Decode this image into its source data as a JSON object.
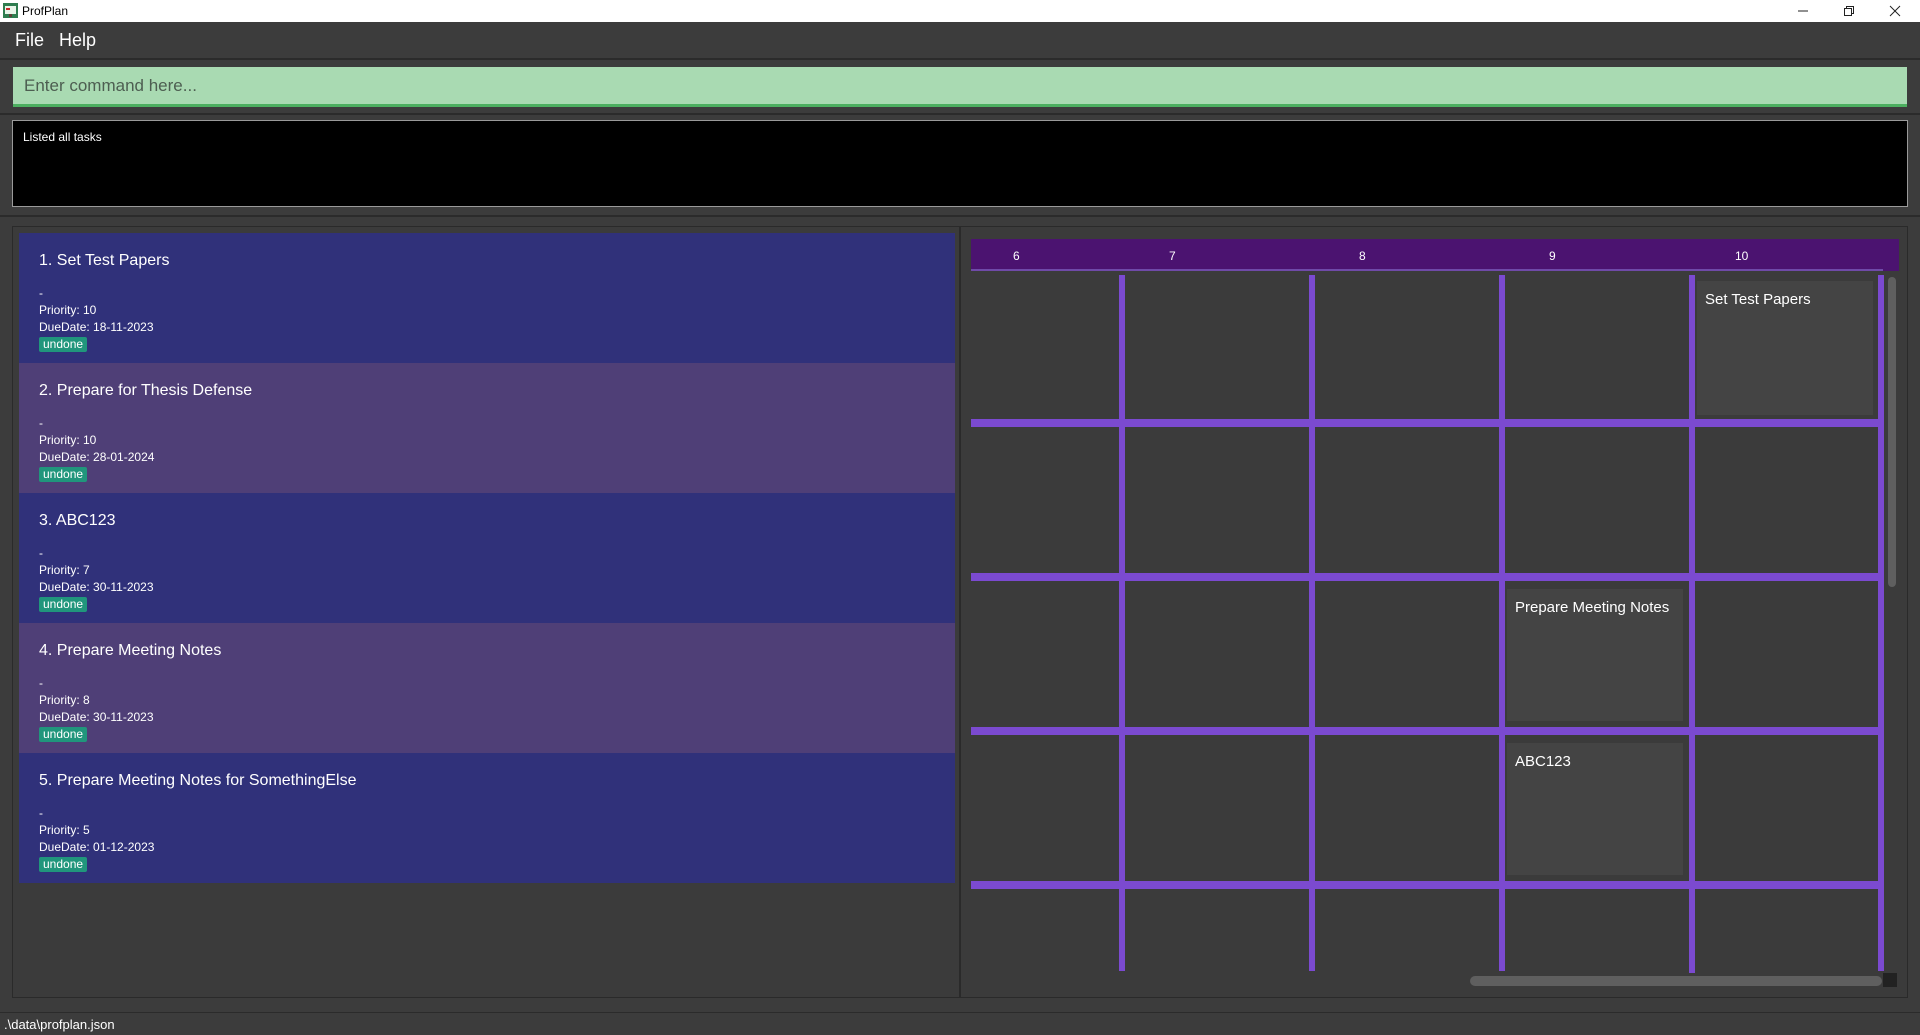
{
  "window": {
    "title": "ProfPlan",
    "icon": "profplan-app-icon"
  },
  "menu": {
    "file": "File",
    "help": "Help"
  },
  "command": {
    "placeholder": "Enter command here...",
    "value": ""
  },
  "result": {
    "text": "Listed all tasks"
  },
  "tasks": [
    {
      "title": "1.  Set Test Papers",
      "desc": "-",
      "priority": "Priority: 10",
      "due": "DueDate: 18-11-2023",
      "status": "undone"
    },
    {
      "title": "2.  Prepare for Thesis Defense",
      "desc": "-",
      "priority": "Priority: 10",
      "due": "DueDate: 28-01-2024",
      "status": "undone"
    },
    {
      "title": "3.  ABC123",
      "desc": "-",
      "priority": "Priority: 7",
      "due": "DueDate: 30-11-2023",
      "status": "undone"
    },
    {
      "title": "4.  Prepare Meeting Notes",
      "desc": "-",
      "priority": "Priority: 8",
      "due": "DueDate: 30-11-2023",
      "status": "undone"
    },
    {
      "title": "5.  Prepare Meeting Notes for SomethingElse",
      "desc": "-",
      "priority": "Priority: 5",
      "due": "DueDate: 01-12-2023",
      "status": "undone"
    }
  ],
  "calendar": {
    "days": [
      "6",
      "7",
      "8",
      "9",
      "10"
    ],
    "events": [
      {
        "title": "Set Test Papers"
      },
      {
        "title": "Prepare Meeting Notes"
      },
      {
        "title": "ABC123"
      }
    ]
  },
  "status": {
    "path": ".\\data\\profplan.json"
  },
  "colors": {
    "task_odd": "#30317a",
    "task_even": "#4f3f77",
    "tag": "#20967c",
    "calendar_header": "#4b1370",
    "calendar_grid": "#7b4ad0",
    "command_bg": "#a9dab2"
  }
}
